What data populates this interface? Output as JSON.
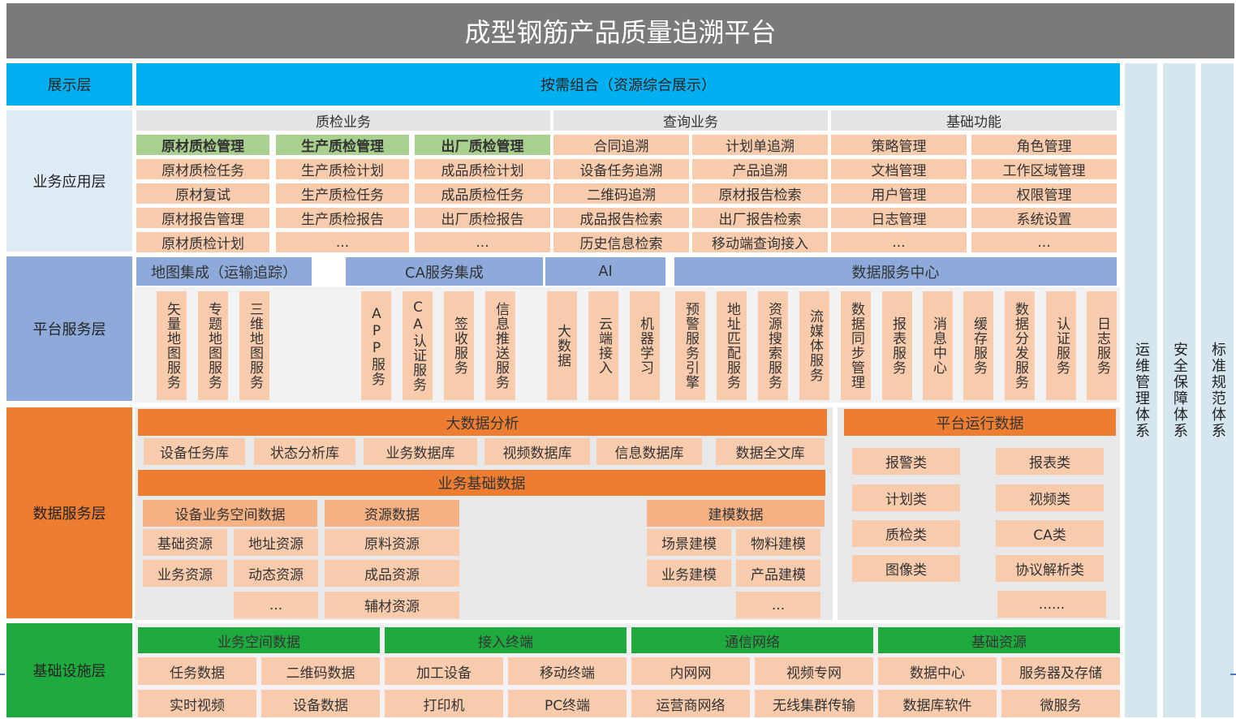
{
  "title": "成型钢筋产品质量追溯平台",
  "colors": {
    "title_bg": "#7a7a7a",
    "cyan": "#00b0f0",
    "light_gray": "#e4e4e4",
    "green_light": "#a9d08e",
    "peach": "#f8cbad",
    "peach_dark": "#f4b183",
    "blue_mid": "#8eaadb",
    "orange": "#ed7d31",
    "green": "#1faa3f",
    "side_blue": "#d6e6ee"
  },
  "layers": {
    "display": "展示层",
    "business": "业务应用层",
    "platform": "平台服务层",
    "data": "数据服务层",
    "infra": "基础设施层"
  },
  "display": {
    "banner": "按需组合（资源综合展示）"
  },
  "business": {
    "groups": [
      "质检业务",
      "查询业务",
      "基础功能"
    ],
    "columns": [
      {
        "header": "原材质检管理",
        "items": [
          "原材质检任务",
          "原材复试",
          "原材报告管理",
          "原材质检计划"
        ]
      },
      {
        "header": "生产质检管理",
        "items": [
          "生产质检计划",
          "生产质检任务",
          "生产质检报告",
          "..."
        ]
      },
      {
        "header": "出厂质检管理",
        "items": [
          "成品质检计划",
          "成品质检任务",
          "出厂质检报告",
          "..."
        ]
      },
      {
        "header": "合同追溯",
        "items": [
          "设备任务追溯",
          "二维码追溯",
          "成品报告检索",
          "历史信息检索"
        ]
      },
      {
        "header": "计划单追溯",
        "items": [
          "产品追溯",
          "原材报告检索",
          "出厂报告检索",
          "移动端查询接入"
        ]
      },
      {
        "header": "策略管理",
        "items": [
          "文档管理",
          "用户管理",
          "日志管理",
          "..."
        ]
      },
      {
        "header": "角色管理",
        "items": [
          "工作区域管理",
          "权限管理",
          "系统设置",
          "..."
        ]
      }
    ]
  },
  "platform": {
    "headers": [
      "地图集成（运输追踪）",
      "CA服务集成",
      "AI",
      "数据服务中心"
    ],
    "services": [
      "矢量地图服务",
      "专题地图服务",
      "三维地图服务",
      "APP服务",
      "CA认证服务",
      "签收服务",
      "信息推送服务",
      "大数据",
      "云端接入",
      "机器学习",
      "预警服务引擎",
      "地址匹配服务",
      "资源搜索服务",
      "流媒体服务",
      "数据同步管理",
      "报表服务",
      "消息中心",
      "缓存服务",
      "数据分发服务",
      "认证服务",
      "日志服务"
    ]
  },
  "data_layer": {
    "bigdata_header": "大数据分析",
    "bigdata_items": [
      "设备任务库",
      "状态分析库",
      "业务数据库",
      "视频数据库",
      "信息数据库",
      "数据全文库"
    ],
    "basic_header": "业务基础数据",
    "spatial": {
      "header": "设备业务空间数据",
      "items": [
        "基础资源",
        "地址资源",
        "业务资源",
        "动态资源",
        "..."
      ]
    },
    "resource": {
      "header": "资源数据",
      "items": [
        "原料资源",
        "成品资源",
        "辅材资源"
      ]
    },
    "model": {
      "header": "建模数据",
      "items": [
        "场景建模",
        "物料建模",
        "业务建模",
        "产品建模",
        "..."
      ]
    },
    "runtime_header": "平台运行数据",
    "runtime_items": [
      "报警类",
      "报表类",
      "计划类",
      "视频类",
      "质检类",
      "CA类",
      "图像类",
      "协议解析类",
      "......"
    ]
  },
  "infra": {
    "groups": [
      {
        "header": "业务空间数据",
        "items": [
          "任务数据",
          "二维码数据",
          "实时视频",
          "设备数据"
        ]
      },
      {
        "header": "接入终端",
        "items": [
          "加工设备",
          "移动终端",
          "打印机",
          "PC终端"
        ]
      },
      {
        "header": "通信网络",
        "items": [
          "内网网",
          "视频专网",
          "运营商网络",
          "无线集群传输"
        ]
      },
      {
        "header": "基础资源",
        "items": [
          "数据中心",
          "服务器及存储",
          "数据库软件",
          "微服务"
        ]
      }
    ]
  },
  "side_systems": [
    "运维管理体系",
    "安全保障体系",
    "标准规范体系"
  ]
}
